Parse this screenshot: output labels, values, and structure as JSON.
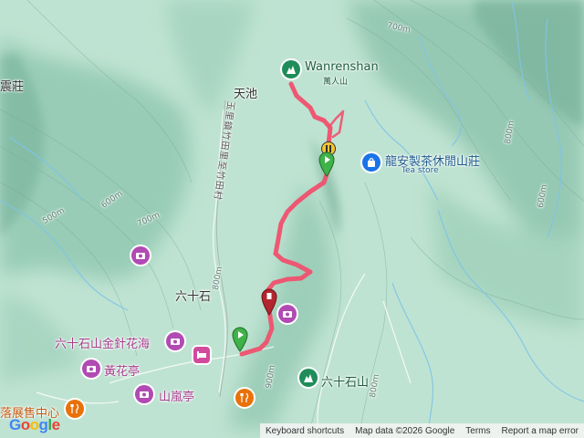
{
  "map": {
    "labels": {
      "wanrenshan": "Wanrenshan",
      "wanrenshan_zh": "萬人山",
      "tianchi": "天池",
      "longan": "龍安製茶休閒山莊",
      "tea_store": "Tea store",
      "liushishi": "六十石",
      "jinzhen": "六十石山金針花海",
      "huanghua": "黃花亭",
      "shanlan": "山嵐亭",
      "liushishishan": "六十石山",
      "zhen": "震莊",
      "zhanshou": "落展售中心",
      "road": "玉里鎮竹田里至竹田村",
      "contour_700_top": "700m",
      "contour_800_right": "800m",
      "contour_600_right": "600m",
      "contour_500": "500m",
      "contour_600": "600m",
      "contour_700": "700m",
      "contour_800": "800m",
      "contour_900": "900m",
      "contour_800_b": "800m"
    },
    "icons": {
      "peak": "mountain-icon",
      "tea": "shopping-bag-icon",
      "camera": "camera-icon",
      "hotel": "hotel-icon",
      "food": "restaurant-icon",
      "start": "green-flag-icon",
      "end": "red-pin-icon",
      "pause": "pause-marker-icon"
    },
    "colors": {
      "track": "#f0506e",
      "terrain_light": "#bfe3d2",
      "terrain_dark": "#8ec3ad",
      "stream": "#7fc4e8"
    }
  },
  "footer": {
    "keyboard": "Keyboard shortcuts",
    "mapdata": "Map data ©2026 Google",
    "terms": "Terms",
    "report": "Report a map error"
  },
  "logo": "Google"
}
